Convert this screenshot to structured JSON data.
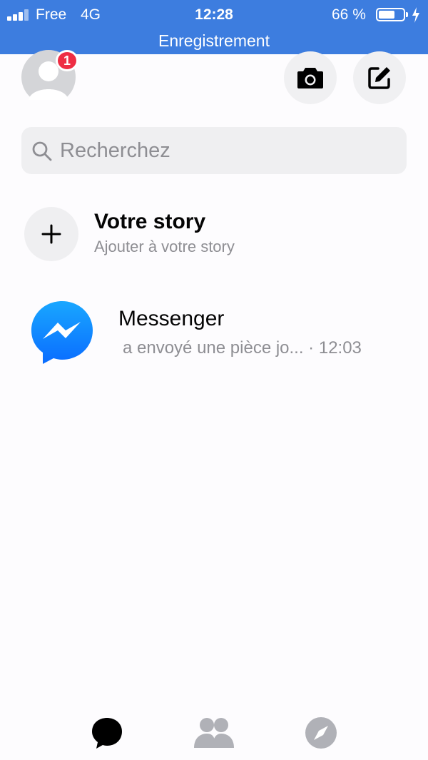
{
  "status_bar": {
    "carrier": "Free",
    "network": "4G",
    "time": "12:28",
    "battery_percent": "66 %",
    "battery_level": 0.66,
    "recording_label": "Enregistrement",
    "background_color": "#3d7ddf"
  },
  "header": {
    "notification_count": "1",
    "avatar_icon": "default-avatar-icon",
    "camera_icon": "camera-icon",
    "compose_icon": "compose-icon"
  },
  "search": {
    "placeholder": "Recherchez",
    "value": ""
  },
  "story": {
    "title": "Votre story",
    "subtitle": "Ajouter à votre story",
    "icon": "plus-icon"
  },
  "conversations": [
    {
      "name": "Messenger",
      "preview": "a envoyé une pièce jo... · 12:03",
      "avatar_icon": "messenger-logo-icon",
      "avatar_color": "#1a8cff"
    }
  ],
  "tabs": [
    {
      "name": "chats",
      "icon": "chat-bubble-icon",
      "active": true
    },
    {
      "name": "people",
      "icon": "people-icon",
      "active": false
    },
    {
      "name": "discover",
      "icon": "compass-icon",
      "active": false
    }
  ],
  "colors": {
    "accent": "#3d7ddf",
    "badge": "#ee2d44",
    "secondary_text": "#8e8e93",
    "inactive_tab": "#b0b1b7"
  }
}
